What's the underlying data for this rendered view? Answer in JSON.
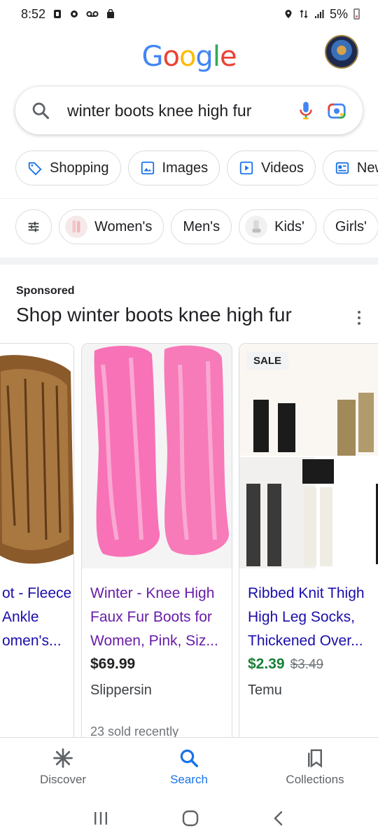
{
  "status_bar": {
    "time": "8:52",
    "battery": "5%"
  },
  "header": {
    "logo_text": [
      "G",
      "o",
      "o",
      "g",
      "l",
      "e"
    ],
    "logo_colors": [
      "#4285F4",
      "#EA4335",
      "#FBBC05",
      "#4285F4",
      "#34A853",
      "#EA4335"
    ]
  },
  "search": {
    "query": "winter boots knee high fur"
  },
  "tabs": [
    {
      "label": "Shopping",
      "icon": "tag-icon"
    },
    {
      "label": "Images",
      "icon": "image-icon"
    },
    {
      "label": "Videos",
      "icon": "play-icon"
    },
    {
      "label": "New",
      "icon": "news-icon"
    }
  ],
  "filters": [
    {
      "label": "Women's"
    },
    {
      "label": "Men's"
    },
    {
      "label": "Kids'"
    },
    {
      "label": "Girls'"
    }
  ],
  "section": {
    "sponsored_label": "Sponsored",
    "title": "Shop winter boots knee high fur"
  },
  "products": [
    {
      "title": "ot - Fleece\nAnkle\nomen's...",
      "price": "",
      "store": "",
      "sale": false
    },
    {
      "title": "Winter - Knee High Faux Fur Boots for Women, Pink, Siz...",
      "price": "$69.99",
      "store": "Slippersin",
      "reviews": "23 sold recently",
      "sale": false
    },
    {
      "title": "Ribbed Knit Thigh High Leg Socks, Thickened Over...",
      "price": "$2.39",
      "old_price": "$3.49",
      "store": "Temu",
      "sale_badge": "SALE",
      "sale": true
    }
  ],
  "bottom_nav": [
    {
      "label": "Discover",
      "icon": "asterisk-icon",
      "active": false
    },
    {
      "label": "Search",
      "icon": "search-icon",
      "active": true
    },
    {
      "label": "Collections",
      "icon": "collections-icon",
      "active": false
    }
  ]
}
